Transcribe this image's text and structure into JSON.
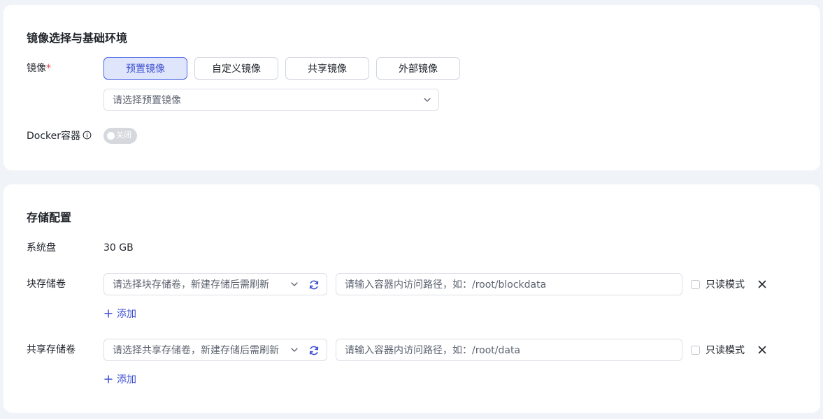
{
  "image_section": {
    "title": "镜像选择与基础环境",
    "image_label": "镜像",
    "required_mark": "*",
    "tabs": [
      {
        "label": "预置镜像",
        "active": true
      },
      {
        "label": "自定义镜像",
        "active": false
      },
      {
        "label": "共享镜像",
        "active": false
      },
      {
        "label": "外部镜像",
        "active": false
      }
    ],
    "image_select_placeholder": "请选择预置镜像",
    "docker_label": "Docker容器",
    "docker_toggle_label": "关闭",
    "docker_enabled": false
  },
  "storage_section": {
    "title": "存储配置",
    "system_disk_label": "系统盘",
    "system_disk_value": "30 GB",
    "block_volume": {
      "label": "块存储卷",
      "select_placeholder": "请选择块存储卷，新建存储后需刷新",
      "path_placeholder": "请输入容器内访问路径，如：/root/blockdata",
      "readonly_label": "只读模式",
      "add_label": "添加"
    },
    "shared_volume": {
      "label": "共享存储卷",
      "select_placeholder": "请选择共享存储卷，新建存储后需刷新",
      "path_placeholder": "请输入容器内访问路径，如：/root/data",
      "readonly_label": "只读模式",
      "add_label": "添加"
    }
  },
  "colors": {
    "accent": "#3d4fd1",
    "active_tab_bg": "#dfe6fb",
    "required": "#e5484d",
    "page_bg": "#f0f3f7"
  },
  "icons": {
    "dropdown": "chevron-down-icon",
    "refresh": "refresh-icon",
    "close": "close-icon",
    "add": "plus-icon",
    "info": "info-icon"
  }
}
